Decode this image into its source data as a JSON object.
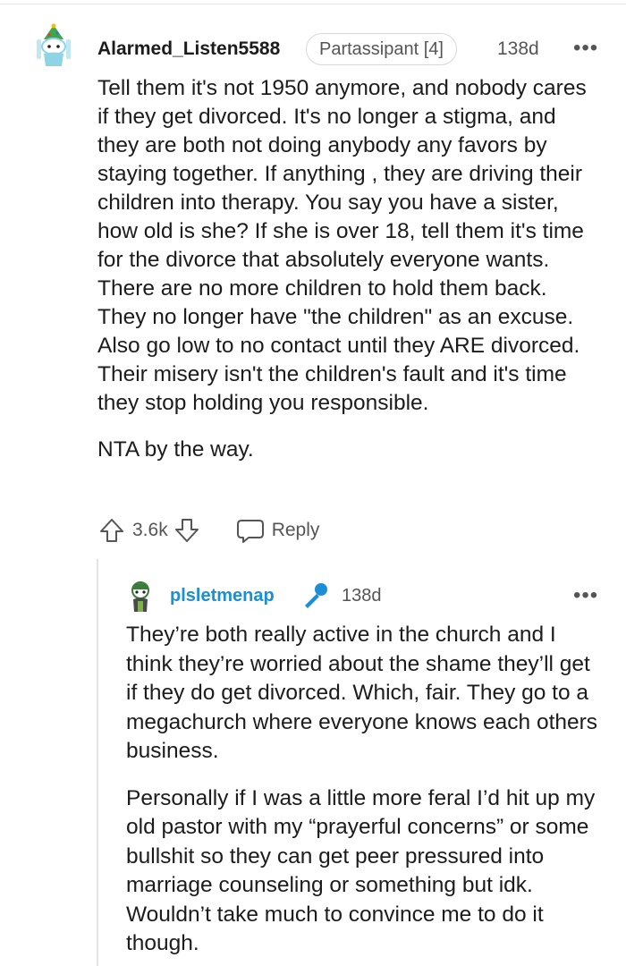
{
  "colors": {
    "text": "#1c1c1c",
    "muted": "#555555",
    "op_username": "#1a8fd6",
    "divider": "#e4e4e4"
  },
  "comment": {
    "username": "Alarmed_Listen5588",
    "flair": "Partassipant [4]",
    "age": "138d",
    "more_icon": "more-options-icon",
    "paragraphs": [
      "Tell them it's not 1950 anymore, and nobody cares if they get divorced. It's no longer a stigma, and they are both not doing anybody any favors by staying together. If anything , they are driving their children into therapy. You say you have a sister, how old is she? If she is over 18, tell them it's time for the divorce that absolutely everyone wants. There are no more children to hold them back. They no longer have \"the children\" as an excuse. Also go low to no contact until they ARE divorced. Their misery isn't the children's fault and it's time they stop holding you responsible.",
      "NTA by the way."
    ],
    "vote_count": "3.6k",
    "reply_label": "Reply"
  },
  "reply": {
    "username": "plsletmenap",
    "badge_icon": "microphone-icon",
    "age": "138d",
    "paragraphs": [
      "They’re both really active in the church and I think they’re worried about the shame they’ll get if they do get divorced. Which, fair. They go to a megachurch where everyone knows each others business.",
      "Personally if I was a little more feral I’d hit up my old pastor with my “prayerful concerns” or some bullshit so they can get peer pressured into marriage counseling or something but idk. Wouldn’t take much to convince me to do it though."
    ]
  }
}
